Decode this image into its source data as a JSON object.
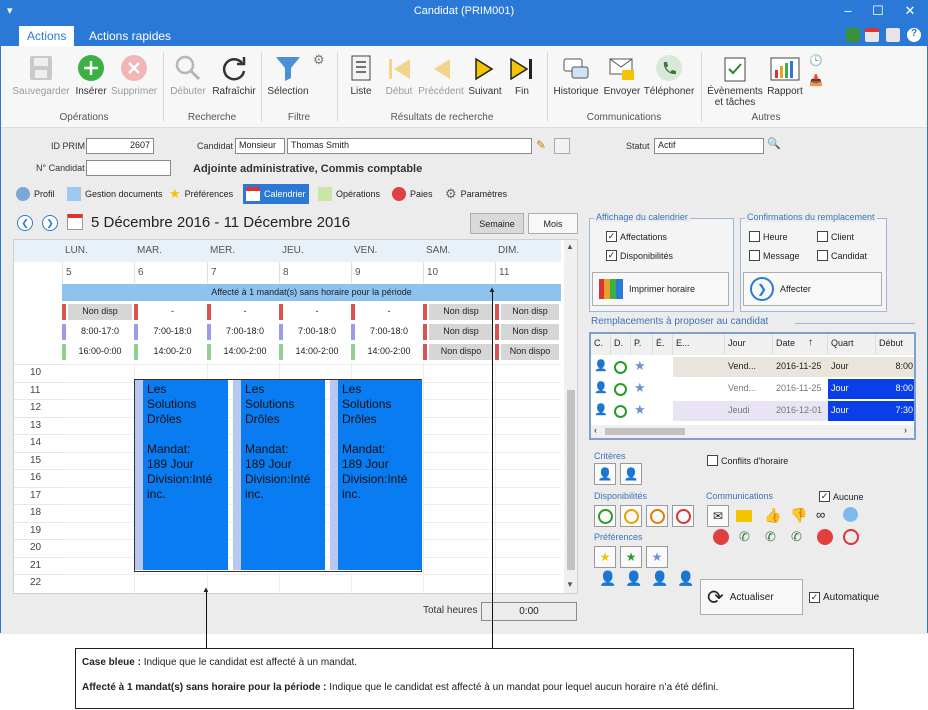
{
  "window": {
    "title": "Candidat (PRIM001)"
  },
  "ribbon_tabs": [
    {
      "label": "Actions"
    },
    {
      "label": "Actions rapides"
    }
  ],
  "ribbon": {
    "buttons": [
      {
        "label": "Sauvegarder",
        "icon": "save-icon"
      },
      {
        "label": "Insérer",
        "icon": "add-icon"
      },
      {
        "label": "Supprimer",
        "icon": "delete-icon"
      },
      {
        "label": "Débuter",
        "icon": "search-icon"
      },
      {
        "label": "Rafraîchir",
        "icon": "refresh-icon"
      },
      {
        "label": "Sélection",
        "icon": "filter-icon"
      },
      {
        "label": "Liste",
        "icon": "list-icon"
      },
      {
        "label": "Début",
        "icon": "first-icon"
      },
      {
        "label": "Précédent",
        "icon": "previous-icon"
      },
      {
        "label": "Suivant",
        "icon": "next-icon"
      },
      {
        "label": "Fin",
        "icon": "last-icon"
      },
      {
        "label": "Historique",
        "icon": "history-icon"
      },
      {
        "label": "Envoyer",
        "icon": "send-mail-icon"
      },
      {
        "label": "Téléphoner",
        "icon": "phone-icon"
      },
      {
        "label": "Évènements et tâches",
        "icon": "tasks-icon"
      },
      {
        "label": "Rapport",
        "icon": "report-icon"
      }
    ],
    "groups": [
      {
        "label": "Opérations"
      },
      {
        "label": "Recherche"
      },
      {
        "label": "Filtre"
      },
      {
        "label": "Résultats de recherche"
      },
      {
        "label": "Communications"
      },
      {
        "label": "Autres"
      }
    ]
  },
  "form": {
    "id_prim_label": "ID PRIM",
    "id_prim": "2607",
    "candidat_label": "Candidat",
    "salutation": "Monsieur",
    "name": "Thomas Smith",
    "statut_label": "Statut",
    "statut": "Actif",
    "no_candidat_label": "N° Candidat",
    "no_candidat": "",
    "job_title": "Adjointe administrative, Commis comptable"
  },
  "profile_tabs": [
    {
      "label": "Profil"
    },
    {
      "label": "Gestion documents"
    },
    {
      "label": "Préférences"
    },
    {
      "label": "Calendrier"
    },
    {
      "label": "Opérations"
    },
    {
      "label": "Paies"
    },
    {
      "label": "Paramètres"
    }
  ],
  "calendar": {
    "range": "5 Décembre 2016 - 11 Décembre 2016",
    "week_btn": "Semaine",
    "month_btn": "Mois",
    "days": [
      {
        "name": "LUN.",
        "num": "5"
      },
      {
        "name": "MAR.",
        "num": "6"
      },
      {
        "name": "MER.",
        "num": "7"
      },
      {
        "name": "JEU.",
        "num": "8"
      },
      {
        "name": "VEN.",
        "num": "9"
      },
      {
        "name": "SAM.",
        "num": "10"
      },
      {
        "name": "DIM.",
        "num": "11"
      }
    ],
    "banner": "Affecté à 1 mandat(s) sans horaire pour la période",
    "rows": [
      [
        "Non disp",
        "-",
        "-",
        "-",
        "-",
        "Non disp",
        "Non disp"
      ],
      [
        "8:00-17:0",
        "7:00-18:0",
        "7:00-18:0",
        "7:00-18:0",
        "7:00-18:0",
        "Non disp",
        "Non disp"
      ],
      [
        "16:00-0:00",
        "14:00-2:0",
        "14:00-2:00",
        "14:00-2:00",
        "14:00-2:00",
        "Non dispo",
        "Non dispo"
      ]
    ],
    "hours": [
      "10",
      "11",
      "12",
      "13",
      "14",
      "15",
      "16",
      "17",
      "18",
      "19",
      "20",
      "21",
      "22"
    ],
    "mandate_text": "Les\nSolutions\nDrôles\n\nMandat:\n189 Jour\nDivision:Inté\ninc.",
    "total_label": "Total heures",
    "total": "0:00"
  },
  "display": {
    "title": "Affichage du calendrier",
    "affectations": "Affectations",
    "disponibilites": "Disponibilités",
    "print": "Imprimer horaire"
  },
  "confirm": {
    "title": "Confirmations du remplacement",
    "heure": "Heure",
    "client": "Client",
    "message": "Message",
    "candidat": "Candidat",
    "assign": "Affecter"
  },
  "repl": {
    "title": "Remplacements à proposer au candidat",
    "headers": [
      "C.",
      "D.",
      "P.",
      "É.",
      "E...",
      "Jour",
      "Date",
      "Quart",
      "Début"
    ],
    "rows": [
      {
        "jour": "Vend...",
        "date": "2016-11-25",
        "quart": "Jour",
        "debut": "8:00"
      },
      {
        "jour": "Vend...",
        "date": "2016-11-25",
        "quart": "Jour",
        "debut": "8:00"
      },
      {
        "jour": "Jeudi",
        "date": "2016-12-01",
        "quart": "Jour",
        "debut": "7:30"
      }
    ]
  },
  "filters": {
    "criteres": "Critères",
    "conflits": "Conflits d'horaire",
    "dispos": "Disponibilités",
    "comms": "Communications",
    "aucune": "Aucune",
    "prefs": "Préférences",
    "refresh": "Actualiser",
    "auto": "Automatique"
  },
  "notes": {
    "blue_label": "Case bleue :",
    "blue_text": "Indique que le candidat est affecté à un mandat.",
    "assigned_label": "Affecté à 1 mandat(s) sans horaire pour la période :",
    "assigned_text": "Indique que le candidat est affecté à un mandat pour lequel aucun horaire n’a été défini."
  },
  "colors": {
    "accent": "#2b79d6",
    "mandate": "#0a7cf2",
    "banner": "#8ec3f0",
    "selected_row": "#0a3ee8"
  }
}
